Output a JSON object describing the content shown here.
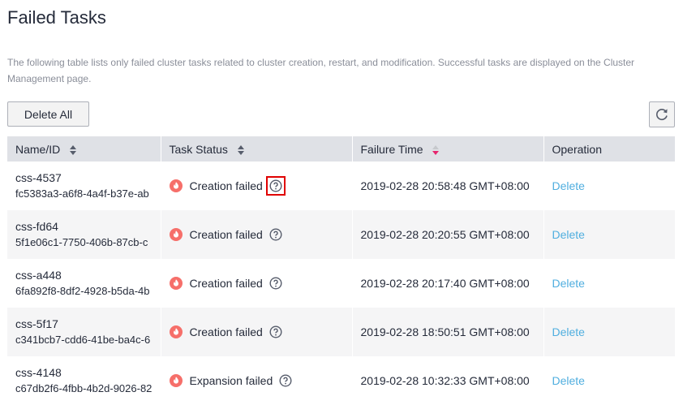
{
  "page": {
    "title": "Failed Tasks",
    "description": "The following table lists only failed cluster tasks related to cluster creation, restart, and modification. Successful tasks are displayed on the Cluster Management page."
  },
  "toolbar": {
    "delete_all_label": "Delete All",
    "refresh_icon": "refresh-icon"
  },
  "table": {
    "columns": [
      {
        "label": "Name/ID",
        "sort": "none"
      },
      {
        "label": "Task Status",
        "sort": "none"
      },
      {
        "label": "Failure Time",
        "sort": "descending"
      },
      {
        "label": "Operation",
        "sort": null
      }
    ],
    "rows": [
      {
        "name": "css-4537",
        "id": "fc5383a3-a6f8-4a4f-b37e-ab",
        "status": "Creation failed",
        "time": "2019-02-28 20:58:48 GMT+08:00",
        "action": "Delete"
      },
      {
        "name": "css-fd64",
        "id": "5f1e06c1-7750-406b-87cb-c",
        "status": "Creation failed",
        "time": "2019-02-28 20:20:55 GMT+08:00",
        "action": "Delete"
      },
      {
        "name": "css-a448",
        "id": "6fa892f8-8df2-4928-b5da-4b",
        "status": "Creation failed",
        "time": "2019-02-28 20:17:40 GMT+08:00",
        "action": "Delete"
      },
      {
        "name": "css-5f17",
        "id": "c341bcb7-cdd6-41be-ba4c-6",
        "status": "Creation failed",
        "time": "2019-02-28 18:50:51 GMT+08:00",
        "action": "Delete"
      },
      {
        "name": "css-4148",
        "id": "c67db2f6-4fbb-4b2d-9026-82",
        "status": "Expansion failed",
        "time": "2019-02-28 10:32:33 GMT+08:00",
        "action": "Delete"
      }
    ]
  },
  "colors": {
    "failure_icon": "#f66f6a",
    "link": "#4faedf",
    "highlight_border": "#e00000",
    "header_bg": "#dfe1e6",
    "sort_active": "#e6266e"
  }
}
